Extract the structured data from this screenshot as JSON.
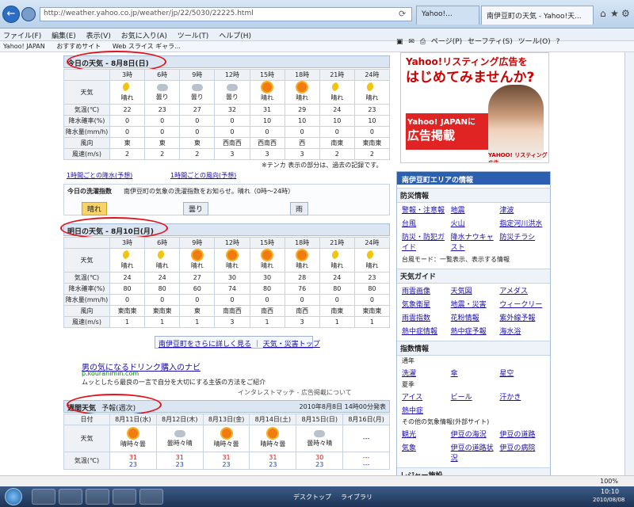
{
  "browser": {
    "address": "http://weather.yahoo.co.jp/weather/jp/22/5030/22225.html",
    "tab1": "Yahoo!...",
    "tab2": "南伊豆町の天気 - Yahoo!天...",
    "menu": [
      "ファイル(F)",
      "編集(E)",
      "表示(V)",
      "お気に入り(A)",
      "ツール(T)",
      "ヘルプ(H)"
    ],
    "favorites": [
      "Yahoo! JAPAN",
      "おすすめサイト",
      "Web スライス ギャラ..."
    ],
    "commands": [
      "ページ(P)",
      "セーフティ(S)",
      "ツール(O)"
    ]
  },
  "today": {
    "title": "今日の天気 - 8月8日(日)",
    "hours": [
      "3時",
      "6時",
      "9時",
      "12時",
      "15時",
      "18時",
      "21時",
      "24時"
    ],
    "labels": [
      "天気",
      "気温(℃)",
      "降水確率(%)",
      "降水量(mm/h)",
      "風向",
      "風速(m/s)"
    ],
    "weather": [
      "晴れ",
      "曇り",
      "曇り",
      "曇り",
      "晴れ",
      "晴れ",
      "晴れ",
      "晴れ"
    ],
    "icons": [
      "moon",
      "cloud",
      "cloud",
      "cloud",
      "sun",
      "sun",
      "moon",
      "moon"
    ],
    "temp": [
      "22",
      "23",
      "27",
      "32",
      "31",
      "29",
      "24",
      "23"
    ],
    "pop": [
      "0",
      "0",
      "0",
      "0",
      "10",
      "10",
      "10",
      "10"
    ],
    "rain": [
      "0",
      "0",
      "0",
      "0",
      "0",
      "0",
      "0",
      "0"
    ],
    "winddir": [
      "東",
      "東",
      "東",
      "西南西",
      "西南西",
      "西",
      "南東",
      "東南東"
    ],
    "windspd": [
      "2",
      "2",
      "2",
      "3",
      "3",
      "3",
      "2",
      "2"
    ],
    "note": "※テンカ 表示の部分は、過去の記録です。",
    "link1": "1時間ごとの降水(予想)",
    "link2": "1時間ごとの風向(予想)"
  },
  "clothing": {
    "label": "今日の洗濯指数",
    "text": "南伊豆町の気象の洗濯指数をお知らせ。晴れ（0時～24時）",
    "opt1": "晴れ",
    "opt2": "曇り",
    "opt3": "雨"
  },
  "tomorrow": {
    "title": "明日の天気 - 8月10日(月)",
    "hours": [
      "3時",
      "6時",
      "9時",
      "12時",
      "15時",
      "18時",
      "21時",
      "24時"
    ],
    "weather": [
      "晴れ",
      "晴れ",
      "晴れ",
      "晴れ",
      "晴れ",
      "晴れ",
      "晴れ",
      "晴れ"
    ],
    "icons": [
      "moon",
      "moon",
      "sun",
      "sun",
      "sun",
      "sun",
      "moon",
      "moon"
    ],
    "temp": [
      "24",
      "24",
      "27",
      "30",
      "30",
      "28",
      "24",
      "23"
    ],
    "pop": [
      "80",
      "80",
      "60",
      "74",
      "80",
      "76",
      "80",
      "80"
    ],
    "rain": [
      "0",
      "0",
      "0",
      "0",
      "0",
      "0",
      "0",
      "0"
    ],
    "winddir": [
      "東南東",
      "東南東",
      "東",
      "南南西",
      "南西",
      "南西",
      "南東",
      "東南東"
    ],
    "windspd": [
      "1",
      "1",
      "1",
      "3",
      "1",
      "3",
      "1",
      "1"
    ]
  },
  "links": {
    "more": "南伊豆町をさらに詳しく見る",
    "sep": "｜",
    "disaster": "天気・災害トップ"
  },
  "ad": {
    "title": "男の気になるドリンク購入のナビ",
    "url": "p.kouranimin.com",
    "desc": "ムッとしたら最良の一言で自分を大切にする主張の方法をご紹介",
    "footer": "インタレストマッチ - 広告掲載について"
  },
  "weekly": {
    "title": "週間天気",
    "tag": "予報(週次)",
    "issued": "2010年8月8日 14時00分発表",
    "dates": [
      "8月11日(水)",
      "8月12日(木)",
      "8月13日(金)",
      "8月14日(土)",
      "8月15日(日)",
      "8月16日(月)"
    ],
    "weather": [
      "晴時々曇",
      "曇時々晴",
      "晴時々曇",
      "晴時々曇",
      "曇時々晴",
      "---"
    ],
    "icons": [
      "sun",
      "cloud",
      "sun",
      "sun",
      "cloud",
      "none"
    ],
    "hi": [
      "31",
      "31",
      "31",
      "31",
      "30",
      "---"
    ],
    "lo": [
      "23",
      "23",
      "23",
      "23",
      "23",
      "---"
    ],
    "rowlabels": [
      "日付",
      "天気",
      "気温(℃)"
    ]
  },
  "rightad": {
    "headline1": "Yahoo!リスティング広告を",
    "headline2": "はじめてみませんか?",
    "badge1": "Yahoo! JAPANに",
    "badge2": "広告掲載",
    "brand": "YAHOO! リスティング広告"
  },
  "area": {
    "title": "南伊豆町エリアの情報",
    "sec1": "防災情報",
    "items1": [
      "警報・注意報",
      "地震",
      "津波",
      "台風",
      "火山",
      "指定河川洪水",
      "防災・防犯ガイド",
      "降水ナウキャスト",
      "防災チラシ"
    ],
    "note1": "台風モード：一覧表示、表示する情報",
    "sec2": "天気ガイド",
    "items2": [
      "雨雲画像",
      "天気図",
      "アメダス",
      "気象衛星",
      "地震・災害",
      "ウィークリー",
      "雨雲指数",
      "花粉情報",
      "紫外線予報",
      "熱中症情報",
      "熱中症予報",
      "海水浴"
    ],
    "sec3": "指数情報",
    "sec3sub": "通年",
    "items3": [
      "洗濯",
      "傘",
      "星空"
    ],
    "sec4": "夏季",
    "items4": [
      "アイス",
      "ビール",
      "汗かき",
      "熱中症"
    ],
    "sec5": "その他の気象情報(外部サイト)",
    "items5": [
      "観光",
      "伊豆の海況",
      "伊豆の道路",
      "気象",
      "伊豆の道路状況",
      "伊豆の病院"
    ],
    "sec6": "レジャー施設"
  },
  "status": {
    "zoom": "100%"
  },
  "taskbar": {
    "item1": "デスクトップ",
    "item2": "ライブラリ",
    "time": "10:10",
    "date": "2010/08/08"
  }
}
